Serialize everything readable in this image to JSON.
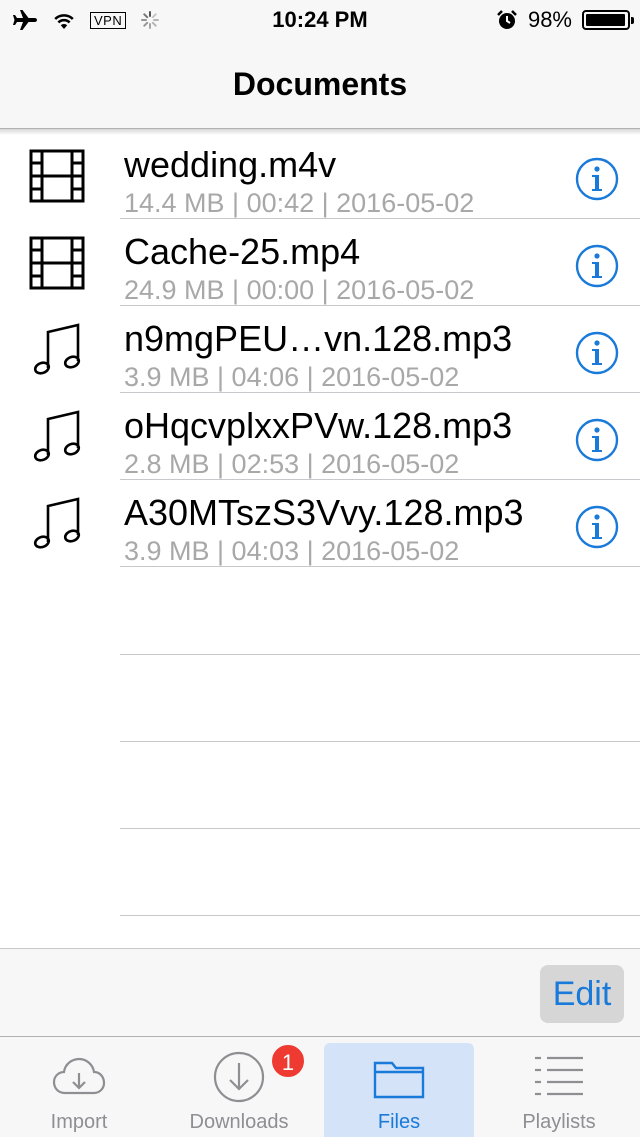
{
  "status_bar": {
    "time": "10:24 PM",
    "vpn_label": "VPN",
    "battery_text": "98%",
    "battery_level": 0.98,
    "icons": [
      "airplane-icon",
      "wifi-icon",
      "vpn-icon",
      "activity-spinner-icon",
      "alarm-icon",
      "battery-icon"
    ]
  },
  "nav": {
    "title": "Documents"
  },
  "files": [
    {
      "name": "wedding.m4v",
      "meta": "14.4 MB | 00:42 | 2016-05-02",
      "icon": "film-icon"
    },
    {
      "name": "Cache-25.mp4",
      "meta": "24.9 MB | 00:00 | 2016-05-02",
      "icon": "film-icon"
    },
    {
      "name": "n9mgPEU…vn.128.mp3",
      "meta": "3.9 MB | 04:06 | 2016-05-02",
      "icon": "music-note-icon"
    },
    {
      "name": "oHqcvplxxPVw.128.mp3",
      "meta": "2.8 MB | 02:53 | 2016-05-02",
      "icon": "music-note-icon"
    },
    {
      "name": "A30MTszS3Vvy.128.mp3",
      "meta": "3.9 MB | 04:03 | 2016-05-02",
      "icon": "music-note-icon"
    }
  ],
  "toolbar": {
    "edit_label": "Edit"
  },
  "tabs": [
    {
      "label": "Import",
      "icon": "cloud-download-icon",
      "active": false
    },
    {
      "label": "Downloads",
      "icon": "download-circle-icon",
      "active": false,
      "badge": "1"
    },
    {
      "label": "Files",
      "icon": "folder-icon",
      "active": true
    },
    {
      "label": "Playlists",
      "icon": "list-icon",
      "active": false
    }
  ],
  "colors": {
    "accent": "#1a7ad9",
    "badge": "#ee3a30",
    "active_tab_bg": "#d4e3f8",
    "meta_text": "#a8a8a8"
  }
}
